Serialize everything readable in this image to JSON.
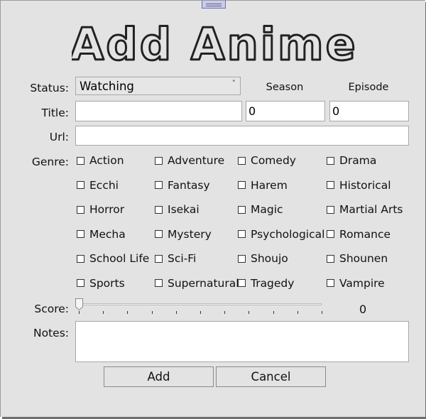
{
  "header": {
    "title": "Add Anime"
  },
  "form": {
    "status_label": "Status:",
    "status_value": "Watching",
    "season_label": "Season",
    "episode_label": "Episode",
    "title_label": "Title:",
    "title_value": "",
    "season_value": "0",
    "episode_value": "0",
    "url_label": "Url:",
    "url_value": "",
    "genre_label": "Genre:",
    "genres": [
      "Action",
      "Adventure",
      "Comedy",
      "Drama",
      "Ecchi",
      "Fantasy",
      "Harem",
      "Historical",
      "Horror",
      "Isekai",
      "Magic",
      "Martial Arts",
      "Mecha",
      "Mystery",
      "Psychological",
      "Romance",
      "School Life",
      "Sci-Fi",
      "Shoujo",
      "Shounen",
      "Sports",
      "Supernatural",
      "Tragedy",
      "Vampire"
    ],
    "score_label": "Score:",
    "score_value": "0",
    "notes_label": "Notes:",
    "notes_value": ""
  },
  "buttons": {
    "add": "Add",
    "cancel": "Cancel"
  }
}
